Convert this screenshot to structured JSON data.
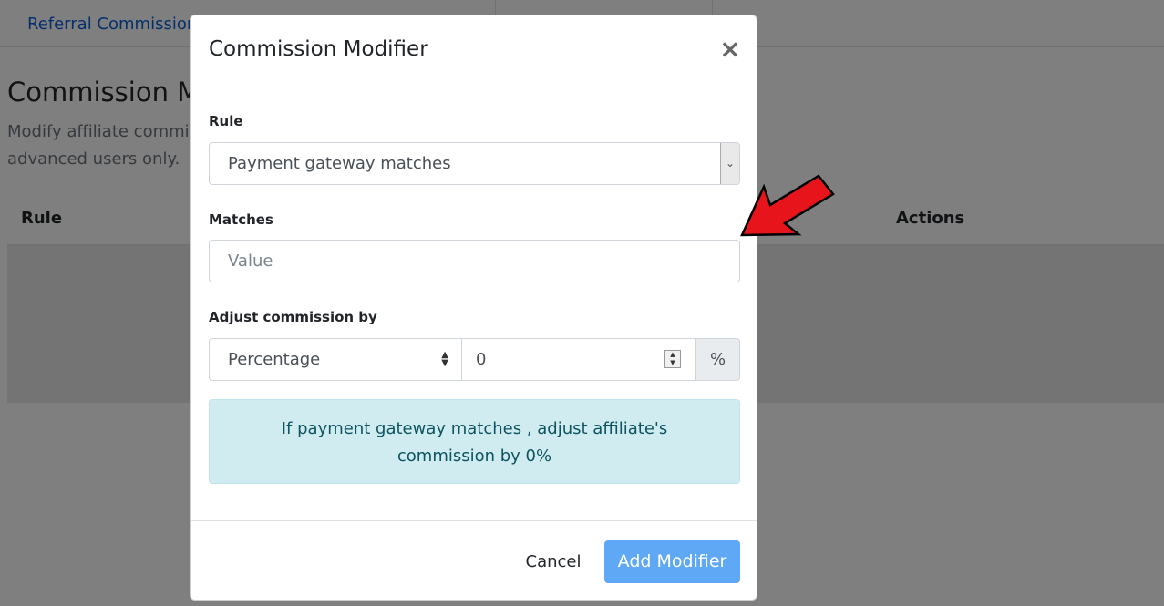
{
  "background": {
    "tab_link": "Referral Commission",
    "heading": "Commission Mo",
    "description_line1": "Modify affiliate commis",
    "description_line2": "advanced users only.",
    "table_headers": {
      "rule": "Rule",
      "actions": "Actions"
    }
  },
  "modal": {
    "title": "Commission Modifier",
    "close": "×",
    "rule_label": "Rule",
    "rule_value": "Payment gateway matches",
    "matches_label": "Matches",
    "matches_placeholder": "Value",
    "adjust_label": "Adjust commission by",
    "adjust_type": "Percentage",
    "adjust_amount": "0",
    "adjust_unit": "%",
    "summary": "If payment gateway matches , adjust affiliate's commission by 0%",
    "cancel_label": "Cancel",
    "add_label": "Add Modifier"
  },
  "colors": {
    "primary_button": "#5fa8f5",
    "alert_bg": "#d1ecf1",
    "annotation_arrow": "#e8141c"
  }
}
